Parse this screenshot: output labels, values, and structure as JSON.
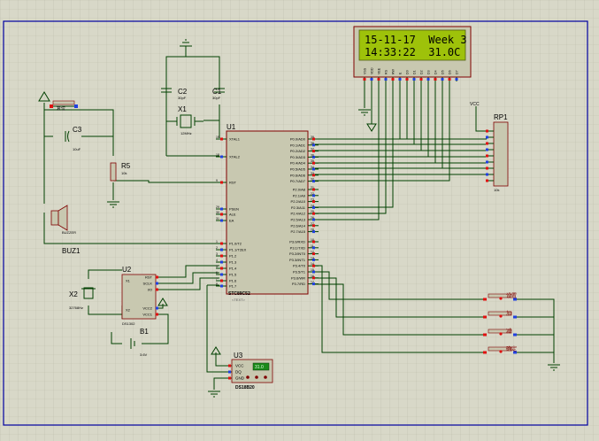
{
  "lcd": {
    "line1": "15-11-17  Week 3",
    "line2": "14:33:22  31.0C",
    "pins": [
      "VSS",
      "VDD",
      "VEE",
      "RS",
      "RW",
      "E",
      "D0",
      "D1",
      "D2",
      "D3",
      "D4",
      "D5",
      "D6",
      "D7"
    ]
  },
  "u1": {
    "ref": "U1",
    "part": "STC89C52",
    "left_pins": [
      "XTAL1",
      "XTAL2",
      "RST",
      "PSEN",
      "ALE",
      "EA",
      "P1.0/T2",
      "P1.1/T2EX",
      "P1.2",
      "P1.3",
      "P1.4",
      "P1.5",
      "P1.6",
      "P1.7"
    ],
    "left_nums": [
      "19",
      "18",
      "9",
      "29",
      "30",
      "31",
      "1",
      "2",
      "3",
      "4",
      "5",
      "6",
      "7",
      "8"
    ],
    "right_pins": [
      "P0.0/AD0",
      "P0.1/AD1",
      "P0.2/AD2",
      "P0.3/AD3",
      "P0.4/AD4",
      "P0.5/AD5",
      "P0.6/AD6",
      "P0.7/AD7",
      "P2.0/A8",
      "P2.1/A9",
      "P2.2/A10",
      "P2.3/A11",
      "P2.4/A12",
      "P2.5/A13",
      "P2.6/A14",
      "P2.7/A15",
      "P3.0/RXD",
      "P3.1/TXD",
      "P3.2/INT0",
      "P3.3/INT1",
      "P3.4/T0",
      "P3.5/T1",
      "P3.6/WR",
      "P3.7/RD"
    ],
    "right_nums": [
      "39",
      "38",
      "37",
      "36",
      "35",
      "34",
      "33",
      "32",
      "21",
      "22",
      "23",
      "24",
      "25",
      "26",
      "27",
      "28",
      "10",
      "11",
      "12",
      "13",
      "14",
      "15",
      "16",
      "17"
    ]
  },
  "components": {
    "c1": {
      "ref": "C1",
      "value": "30pF"
    },
    "c2": {
      "ref": "C2",
      "value": "30pF"
    },
    "c3": {
      "ref": "C3",
      "value": "10uF"
    },
    "x1": {
      "ref": "X1",
      "value": "12MHz"
    },
    "x2": {
      "ref": "X2",
      "value": "32768Hz"
    },
    "r5": {
      "ref": "R5",
      "value": "10k"
    },
    "rp1": {
      "ref": "RP1",
      "value": "10k"
    },
    "buz1": {
      "ref": "BUZ1",
      "value": "BUZZER"
    },
    "b1": {
      "ref": "B1",
      "value": "3.6V"
    },
    "u2": {
      "ref": "U2",
      "part": "DS1302",
      "pins": [
        "X1",
        "X2",
        "GND",
        "RST",
        "SCLK",
        "I/O",
        "VCC2",
        "VCC1"
      ]
    },
    "u3": {
      "ref": "U3",
      "part": "DS18B20",
      "pins": [
        "VCC",
        "DQ",
        "GND"
      ],
      "temp": "31.0"
    },
    "reset_button": {
      "label": "复位"
    }
  },
  "vcc_label": "VCC",
  "text_placeholder": "<TEXT>",
  "buttons": [
    {
      "label": "设置"
    },
    {
      "label": "加"
    },
    {
      "label": "减"
    },
    {
      "label": "确定"
    }
  ],
  "colors": {
    "background": "#d8d8c8",
    "wire": "#004000",
    "frame": "#0000a0",
    "component": "#800000",
    "chip_fill": "#c8c8b0",
    "lcd_green": "#9ec20a",
    "pin_red": "#e01010",
    "pin_blue": "#2040e0"
  }
}
